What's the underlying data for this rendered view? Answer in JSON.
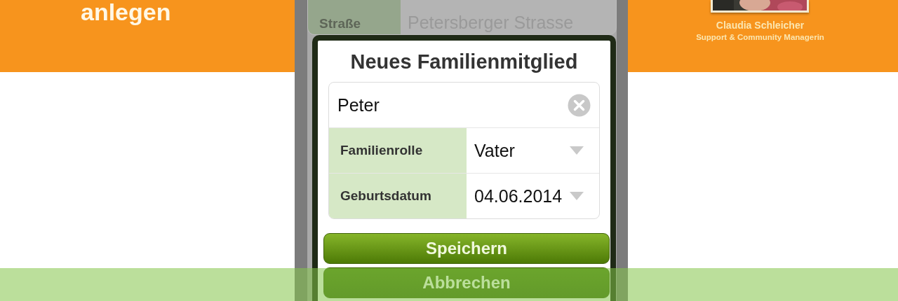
{
  "headline": "anlegen",
  "presenter": {
    "name": "Claudia Schleicher",
    "role": "Support & Community Managerin"
  },
  "background_form": {
    "rows": [
      {
        "label": "Straße",
        "value": "Petersberger Strasse"
      }
    ]
  },
  "dialog": {
    "title": "Neues Familienmitglied",
    "name_field": {
      "value": "Peter"
    },
    "rows": [
      {
        "label": "Familienrolle",
        "value": "Vater"
      },
      {
        "label": "Geburtsdatum",
        "value": "04.06.2014"
      }
    ],
    "buttons": [
      {
        "label": "Speichern",
        "kind": "primary"
      },
      {
        "label": "Abbrechen",
        "kind": "secondary"
      }
    ]
  }
}
